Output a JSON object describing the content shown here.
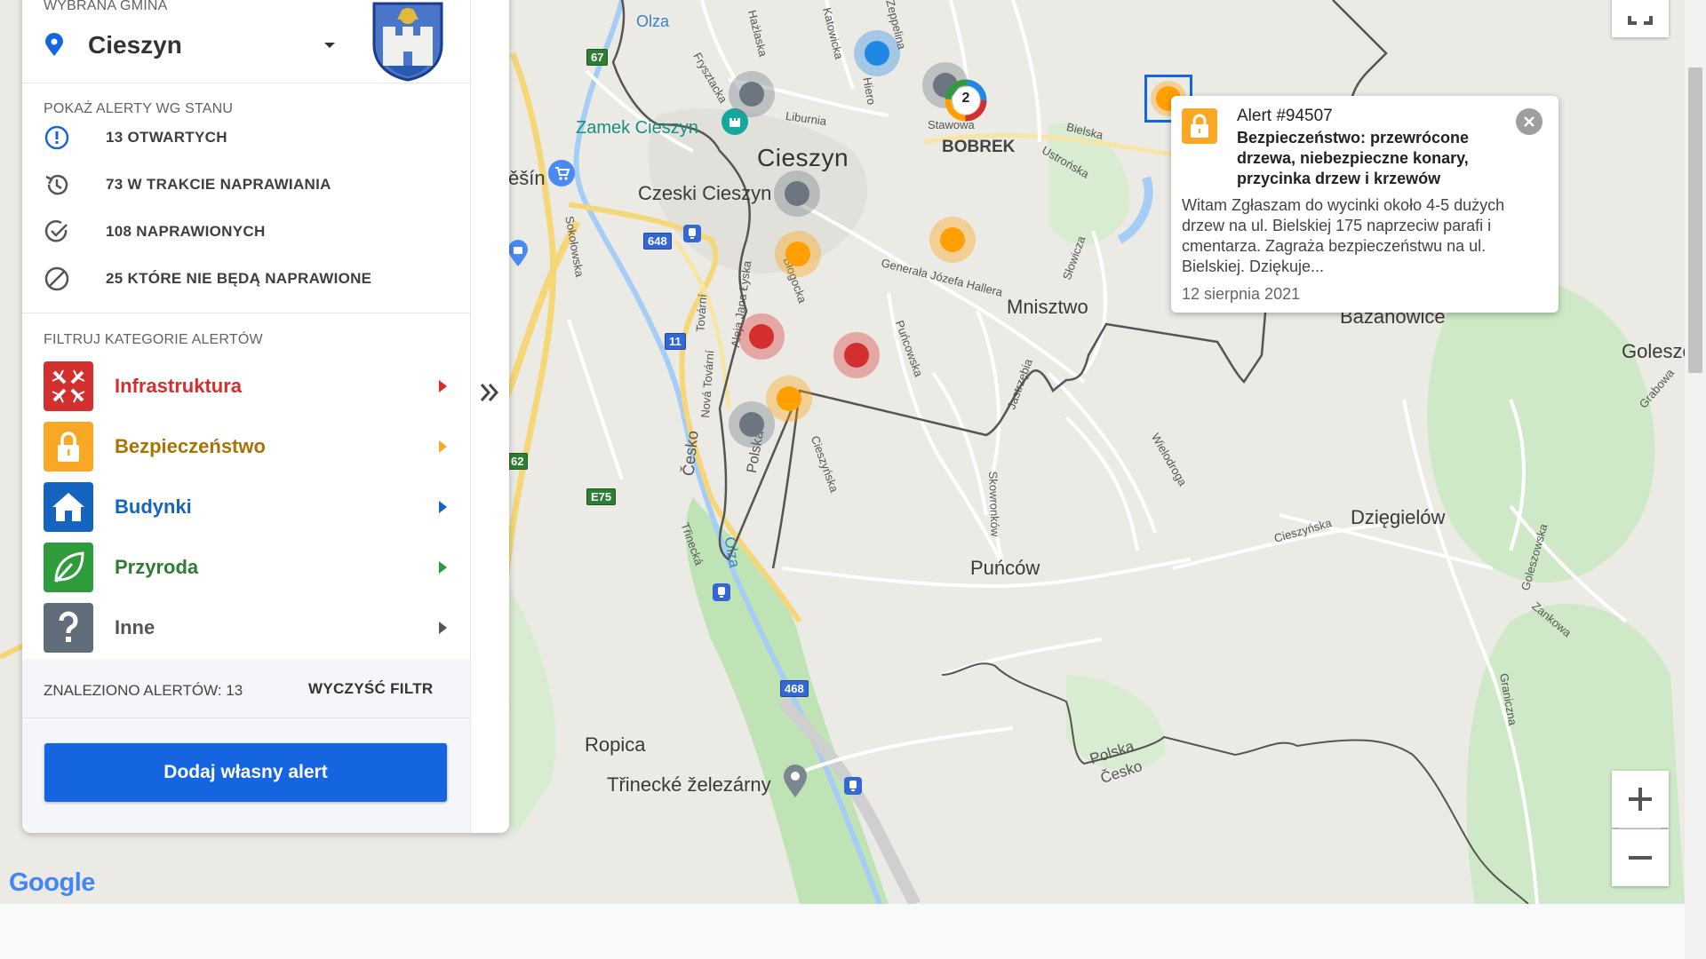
{
  "panel": {
    "gmina_label": "WYBRANA GMINA",
    "gmina_name": "Cieszyn",
    "status_title": "POKAŻ ALERTY WG STANU",
    "statuses": [
      {
        "label": "13 OTWARTYCH",
        "icon": "alert-circle-icon",
        "color": "#1565e0"
      },
      {
        "label": "73 W TRAKCIE NAPRAWIANIA",
        "icon": "history-icon",
        "color": "#444444"
      },
      {
        "label": "108 NAPRAWIONYCH",
        "icon": "check-circle-icon",
        "color": "#444444"
      },
      {
        "label": "25 KTÓRE NIE BĘDĄ NAPRAWIONE",
        "icon": "block-icon",
        "color": "#444444"
      }
    ],
    "category_title": "FILTRUJ KATEGORIE ALERTÓW",
    "categories": [
      {
        "label": "Infrastruktura",
        "color": "#d32f2f",
        "icon": "infrastructure-icon"
      },
      {
        "label": "Bezpieczeństwo",
        "color": "#f9a825",
        "text_color": "#a77400",
        "icon": "lock-icon"
      },
      {
        "label": "Budynki",
        "color": "#1565c0",
        "icon": "house-icon"
      },
      {
        "label": "Przyroda",
        "color": "#2e9c3a",
        "text_color": "#2e7d32",
        "icon": "leaf-icon"
      },
      {
        "label": "Inne",
        "color": "#616d78",
        "text_color": "#555555",
        "icon": "question-icon"
      }
    ],
    "found_label": "ZNALEZIONO ALERTÓW: 13",
    "clear_filter": "WYCZYŚĆ FILTR",
    "add_button": "Dodaj własny alert"
  },
  "popup": {
    "id": "Alert #94507",
    "title": "Bezpieczeństwo: przewrócone drzewa, niebezpieczne konary, przycinka drzew i krzewów",
    "body": "Witam Zgłaszam do wycinki około 4-5 dużych drzew na ul. Bielskiej 175 naprzeciw parafi i cmentarza. Zagraża bezpieczeństwu na ul. Bielskiej. Dziękuje...",
    "date": "12 sierpnia 2021"
  },
  "map": {
    "labels": {
      "cieszyn": "Cieszyn",
      "czeski": "Czeski Cieszyn",
      "zamek": "Zamek Cieszyn",
      "bobrek": "BOBREK",
      "mnisztwo": "Mnisztwo",
      "puncow": "Puńców",
      "dziegielow": "Dzięgielów",
      "ropica": "Ropica",
      "trinecke": "Třinecké železárny",
      "bazanowice": "Bażanowice",
      "goleszow": "Goleszó",
      "olza1": "Olza",
      "olza2": "Olza",
      "tesin": "ěšín",
      "polska": "Polska",
      "cesko": "Česko",
      "stawowa": "Stawowa",
      "liburnia": "Liburnia",
      "bielska": "Bielska",
      "ustronska": "Ustrońska",
      "hallera": "Generała Józefa Hallera",
      "blogocka": "Błogocka",
      "puncowska": "Puńcowska",
      "cieszynska": "Cieszyńska",
      "skowronkow": "Skowronków",
      "jastrzebia": "Jastrzębia",
      "wielodroga": "Wielodroga",
      "slowicza": "Słowicza",
      "cieszynska2": "Cieszyńska",
      "goleszowska": "Goleszowska",
      "zankowa": "Zankowa",
      "graniczna": "Graniczna",
      "grabowa": "Grabowa",
      "sokolowska": "Sokołowska",
      "novatovarni": "Nová Tovární",
      "tovarni": "Tovární",
      "trinecka": "Třinecká",
      "polska_st": "Polská",
      "alejajana": "Aleja Jana Łyska",
      "fryszta": "Frysztacka",
      "hazlaska": "Hażlaska",
      "katowicka": "Katowicka",
      "zeppelina": "Zeppelina",
      "hiero": "Hiero",
      "cesko_st": "Česko",
      "google": "Google"
    },
    "shields": {
      "r67": "67",
      "r648": "648",
      "r11": "11",
      "rE75": "E75",
      "r468": "468",
      "r62": "62"
    },
    "cluster_count": "2"
  },
  "colors": {
    "accent": "#1565e0",
    "marker_orange": "#ffa000",
    "marker_red": "#d32f2f",
    "marker_grey": "#6b7680",
    "marker_blue": "#1e88e5"
  }
}
